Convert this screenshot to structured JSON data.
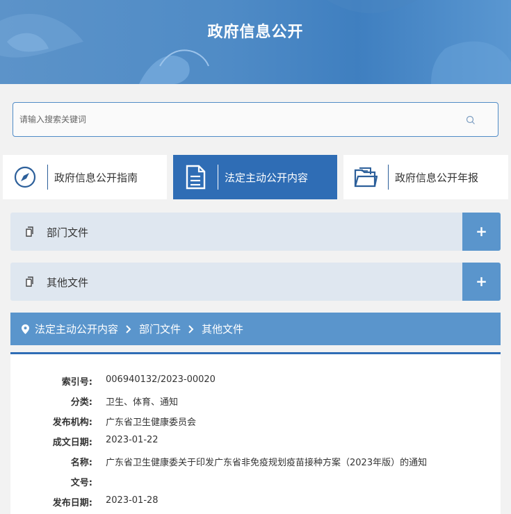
{
  "banner": {
    "title": "政府信息公开"
  },
  "search": {
    "placeholder": "请输入搜索关键词"
  },
  "cards": [
    {
      "label": "政府信息公开指南",
      "icon": "compass-icon"
    },
    {
      "label": "法定主动公开内容",
      "icon": "document-icon"
    },
    {
      "label": "政府信息公开年报",
      "icon": "folder-icon"
    }
  ],
  "accordions": [
    {
      "label": "部门文件",
      "toggle": "+"
    },
    {
      "label": "其他文件",
      "toggle": "+"
    }
  ],
  "breadcrumb": [
    "法定主动公开内容",
    "部门文件",
    "其他文件"
  ],
  "detail": [
    {
      "key": "索引号:",
      "value": "006940132/2023-00020"
    },
    {
      "key": "分类:",
      "value": "卫生、体育、通知"
    },
    {
      "key": "发布机构:",
      "value": "广东省卫生健康委员会"
    },
    {
      "key": "成文日期:",
      "value": "2023-01-22"
    },
    {
      "key": "名称:",
      "value": "广东省卫生健康委关于印发广东省非免疫规划疫苗接种方案（2023年版）的通知"
    },
    {
      "key": "文号:",
      "value": ""
    },
    {
      "key": "发布日期:",
      "value": "2023-01-28"
    }
  ],
  "colors": {
    "primary": "#2f6db5",
    "accent": "#5a95cc",
    "panel": "#dfe7f0",
    "background": "#f2f2f2"
  }
}
